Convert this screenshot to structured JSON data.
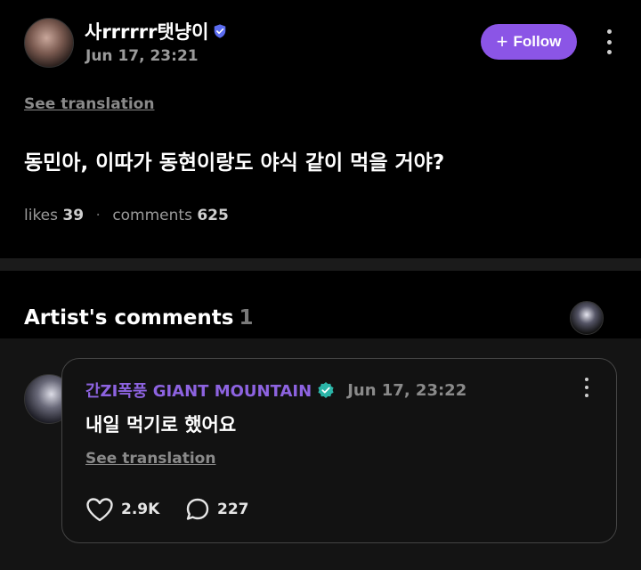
{
  "post": {
    "author_name": "사rrrrrr탯냥이",
    "time": "Jun 17, 23:21",
    "follow_label": "Follow",
    "see_translation": "See translation",
    "body": "동민아, 이따가 동현이랑도 야식 같이 먹을 거야?",
    "likes_label": "likes",
    "likes_count": "39",
    "comments_label": "comments",
    "comments_count": "625",
    "separator": "·"
  },
  "artist_comments": {
    "title": "Artist's comments",
    "count": "1"
  },
  "comment": {
    "author_name": "간ZI폭풍 GIANT MOUNTAIN",
    "time": "Jun 17, 23:22",
    "body": "내일 먹기로 했어요",
    "see_translation": "See translation",
    "like_count": "2.9K",
    "reply_count": "227"
  },
  "colors": {
    "background": "#000000",
    "accent": "#8b55e6",
    "comment_author": "#8d63e0",
    "verified_blue": "#5b6cf0",
    "verified_teal": "#2bb5a8"
  },
  "icons": {
    "verified_post": "verified-shield-icon",
    "verified_comment": "verified-check-icon",
    "like": "heart-icon",
    "reply": "speech-bubble-icon",
    "more": "more-vertical-icon",
    "follow": "plus-icon"
  }
}
